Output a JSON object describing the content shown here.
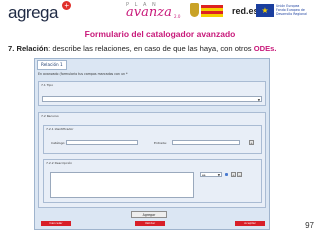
{
  "header": {
    "logo_agrega": "agrega",
    "logo_agrega_badge": "+",
    "logo_plan_small": "P L A N",
    "logo_plan_big": "avanza",
    "logo_plan_tiny": "2.0",
    "logo_reds": "red.es",
    "logo_eu_text": [
      "Unión Europea",
      "Fondo Europeo de Desarrollo Regional"
    ]
  },
  "page_title": "Formulario del catalogador avanzado",
  "description": {
    "number": "7.",
    "label": "Relación",
    "text": ": describe las relaciones, en caso de que las haya, con otros ",
    "accent": "ODEs."
  },
  "form": {
    "title": "Relación 1",
    "question": "En avanzado (formulario tus campos marcados con un *",
    "tipo_label": "7.1 Tipo",
    "recurso_label": "7.2 Recurso",
    "identificador_label": "7.2.1 Identificador",
    "catalogo_label": "Catálogo:",
    "entrada_label": "Entrada:",
    "descripcion_label": "7.2.2 Descripción",
    "idioma_value": "es",
    "add_symbol": "+",
    "remove_symbol": "−"
  },
  "buttons": {
    "agregar": "Agregar",
    "cancelar": "Cancelar",
    "validar": "Validar",
    "aceptar": "Aceptar"
  },
  "colors": {
    "accent": "#c8197a",
    "panel": "#dbe6f3",
    "action_red": "#d81f28"
  },
  "page_number": "97"
}
